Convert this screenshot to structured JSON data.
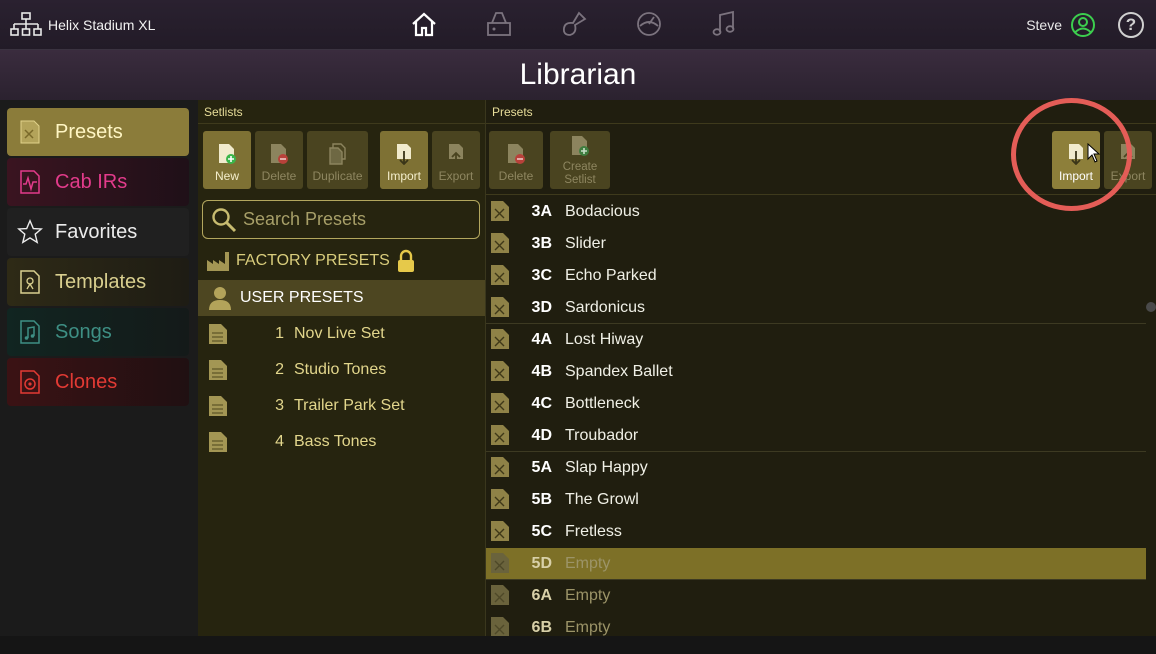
{
  "topbar": {
    "device_name": "Helix Stadium XL",
    "nav_icons": [
      "home-icon",
      "amp-icon",
      "guitar-icon",
      "tuner-icon",
      "music-icon"
    ],
    "user_name": "Steve",
    "help_label": "?"
  },
  "page_title": "Librarian",
  "leftnav": {
    "items": [
      {
        "label": "Presets",
        "icon": "preset-icon",
        "color": "#fff6c4"
      },
      {
        "label": "Cab IRs",
        "icon": "waveform-icon",
        "color": "#e23b8b"
      },
      {
        "label": "Favorites",
        "icon": "star-icon",
        "color": "#ececec"
      },
      {
        "label": "Templates",
        "icon": "template-icon",
        "color": "#d9cf8f"
      },
      {
        "label": "Songs",
        "icon": "song-icon",
        "color": "#3e8f84"
      },
      {
        "label": "Clones",
        "icon": "clone-icon",
        "color": "#e23a34"
      }
    ]
  },
  "setlists": {
    "header": "Setlists",
    "toolbar": {
      "new": "New",
      "delete": "Delete",
      "duplicate": "Duplicate",
      "import": "Import",
      "export": "Export"
    },
    "search_placeholder": "Search Presets",
    "factory_label": "FACTORY PRESETS",
    "user_label": "USER PRESETS",
    "items": [
      {
        "num": "1",
        "name": "Nov Live Set"
      },
      {
        "num": "2",
        "name": "Studio Tones"
      },
      {
        "num": "3",
        "name": "Trailer Park Set"
      },
      {
        "num": "4",
        "name": "Bass Tones"
      }
    ]
  },
  "presets": {
    "header": "Presets",
    "toolbar": {
      "delete": "Delete",
      "create_setlist": "Create Setlist",
      "import": "Import",
      "export": "Export"
    },
    "rows": [
      {
        "slot": "3A",
        "name": "Bodacious"
      },
      {
        "slot": "3B",
        "name": "Slider"
      },
      {
        "slot": "3C",
        "name": "Echo Parked"
      },
      {
        "slot": "3D",
        "name": "Sardonicus"
      },
      {
        "slot": "4A",
        "name": "Lost Hiway"
      },
      {
        "slot": "4B",
        "name": "Spandex Ballet"
      },
      {
        "slot": "4C",
        "name": "Bottleneck"
      },
      {
        "slot": "4D",
        "name": "Troubador"
      },
      {
        "slot": "5A",
        "name": "Slap Happy"
      },
      {
        "slot": "5B",
        "name": "The Growl"
      },
      {
        "slot": "5C",
        "name": "Fretless"
      },
      {
        "slot": "5D",
        "name": "Empty"
      },
      {
        "slot": "6A",
        "name": "Empty"
      },
      {
        "slot": "6B",
        "name": "Empty"
      }
    ]
  },
  "colors": {
    "accent": "#8b7c3a",
    "highlight_ring": "#e45d57",
    "user_online": "#3ccf4e"
  }
}
